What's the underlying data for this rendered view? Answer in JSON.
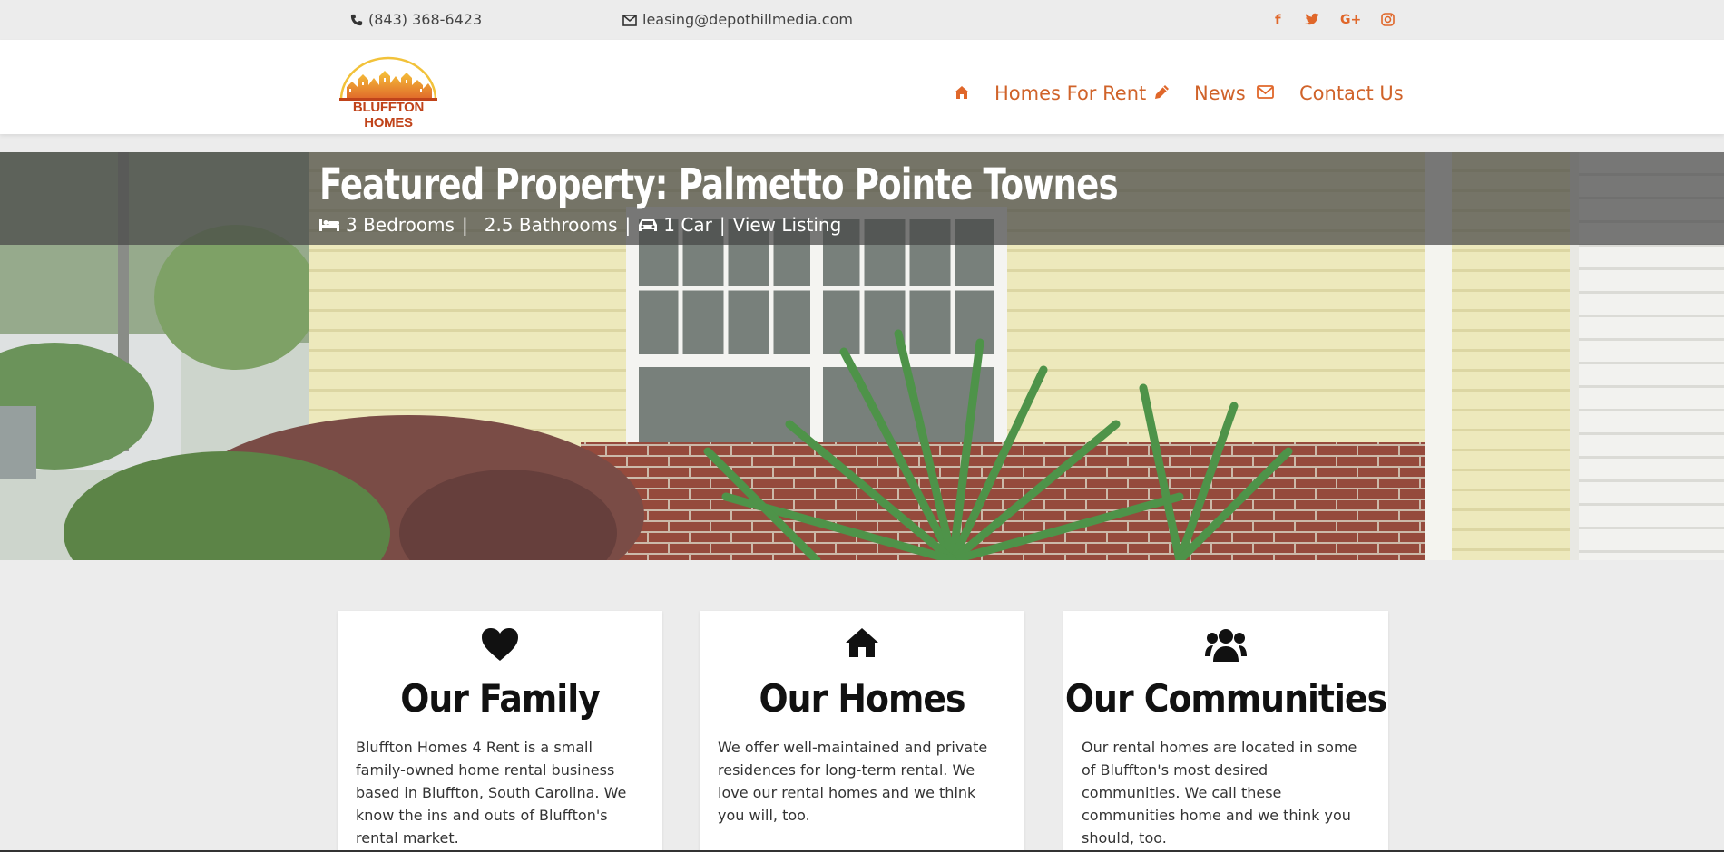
{
  "topbar": {
    "phone": "(843) 368-6423",
    "email": "leasing@depothillmedia.com",
    "social": [
      {
        "name": "facebook",
        "glyph": "f"
      },
      {
        "name": "twitter",
        "glyph": "t"
      },
      {
        "name": "google-plus",
        "glyph": "G+"
      },
      {
        "name": "instagram",
        "glyph": "ig"
      }
    ]
  },
  "logo": {
    "text": "BLUFFTON HOMES"
  },
  "nav": {
    "items": [
      {
        "label": "Homes For Rent",
        "icon": "home-icon"
      },
      {
        "label": "News",
        "icon": "pencil-icon"
      },
      {
        "label": "Contact Us",
        "icon": "envelope-icon"
      }
    ]
  },
  "hero": {
    "title": "Featured Property: Palmetto Pointe Townes",
    "bedrooms": "3 Bedrooms",
    "bathrooms": "2.5 Bathrooms",
    "car": "1 Car",
    "view_listing": "View Listing",
    "sep": "|"
  },
  "cards": [
    {
      "icon": "heart-icon",
      "title": "Our Family",
      "text": "Bluffton Homes 4 Rent is a small family-owned home rental business based in Bluffton, South Carolina. We know the ins and outs of Bluffton's rental market."
    },
    {
      "icon": "home-icon",
      "title": "Our Homes",
      "text": "We offer well-maintained and private residences for long-term rental. We love our rental homes and we think you will, too."
    },
    {
      "icon": "users-icon",
      "title": "Our Communities",
      "text": "Our rental homes are located in some of Bluffton's most desired communities. We call these communities home and we think you should, too."
    }
  ],
  "colors": {
    "accent": "#e0672a",
    "nav_link": "#d0632a",
    "background": "#ececec"
  }
}
